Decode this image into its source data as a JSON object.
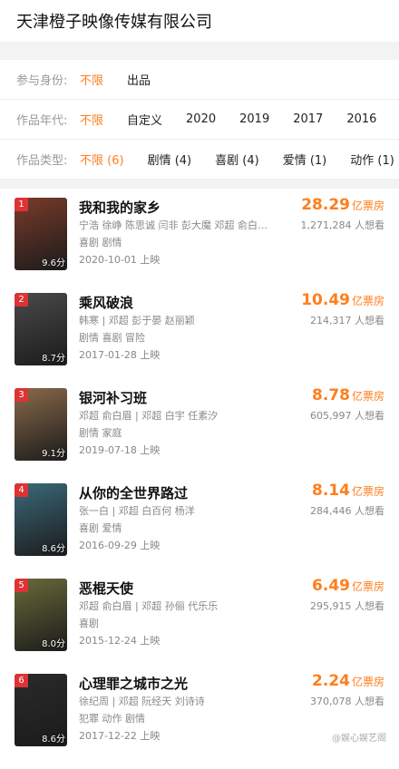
{
  "company": "天津橙子映像传媒有限公司",
  "filters": [
    {
      "label": "参与身份:",
      "options": [
        "不限",
        "出品"
      ],
      "active": 0
    },
    {
      "label": "作品年代:",
      "options": [
        "不限",
        "自定义",
        "2020",
        "2019",
        "2017",
        "2016"
      ],
      "active": 0
    },
    {
      "label": "作品类型:",
      "options": [
        "不限 (6)",
        "剧情 (4)",
        "喜剧 (4)",
        "爱情 (1)",
        "动作 (1)"
      ],
      "active": 0
    }
  ],
  "movies": [
    {
      "rank": "1",
      "score": "9.6分",
      "title": "我和我的家乡",
      "cast": "宁浩  徐峥  陈思诚  闫非  彭大魔  邓超  俞白…",
      "genres": "喜剧  剧情",
      "date": "2020-10-01 上映",
      "box": "28.29",
      "unit": "亿票房",
      "want": "1,271,284 人想看",
      "poster_color": "#7a3b2a"
    },
    {
      "rank": "2",
      "score": "8.7分",
      "title": "乘风破浪",
      "cast": "韩寒 | 邓超  彭于晏  赵丽颖",
      "genres": "剧情  喜剧  冒险",
      "date": "2017-01-28 上映",
      "box": "10.49",
      "unit": "亿票房",
      "want": "214,317 人想看",
      "poster_color": "#4a4a4a"
    },
    {
      "rank": "3",
      "score": "9.1分",
      "title": "银河补习班",
      "cast": "邓超  俞白眉 | 邓超  白宇  任素汐",
      "genres": "剧情  家庭",
      "date": "2019-07-18 上映",
      "box": "8.78",
      "unit": "亿票房",
      "want": "605,997 人想看",
      "poster_color": "#8a6a4a"
    },
    {
      "rank": "4",
      "score": "8.6分",
      "title": "从你的全世界路过",
      "cast": "张一白 | 邓超  白百何  杨洋",
      "genres": "喜剧  爱情",
      "date": "2016-09-29 上映",
      "box": "8.14",
      "unit": "亿票房",
      "want": "284,446 人想看",
      "poster_color": "#3a6a7a"
    },
    {
      "rank": "5",
      "score": "8.0分",
      "title": "恶棍天使",
      "cast": "邓超  俞白眉 | 邓超  孙俪  代乐乐",
      "genres": "喜剧",
      "date": "2015-12-24 上映",
      "box": "6.49",
      "unit": "亿票房",
      "want": "295,915 人想看",
      "poster_color": "#6a6a3a"
    },
    {
      "rank": "6",
      "score": "8.6分",
      "title": "心理罪之城市之光",
      "cast": "徐纪周 | 邓超  阮经天  刘诗诗",
      "genres": "犯罪  动作  剧情",
      "date": "2017-12-22 上映",
      "box": "2.24",
      "unit": "亿票房",
      "want": "370,078 人想看",
      "poster_color": "#2a2a2a"
    }
  ],
  "watermark": "@娱心娱艺阁"
}
